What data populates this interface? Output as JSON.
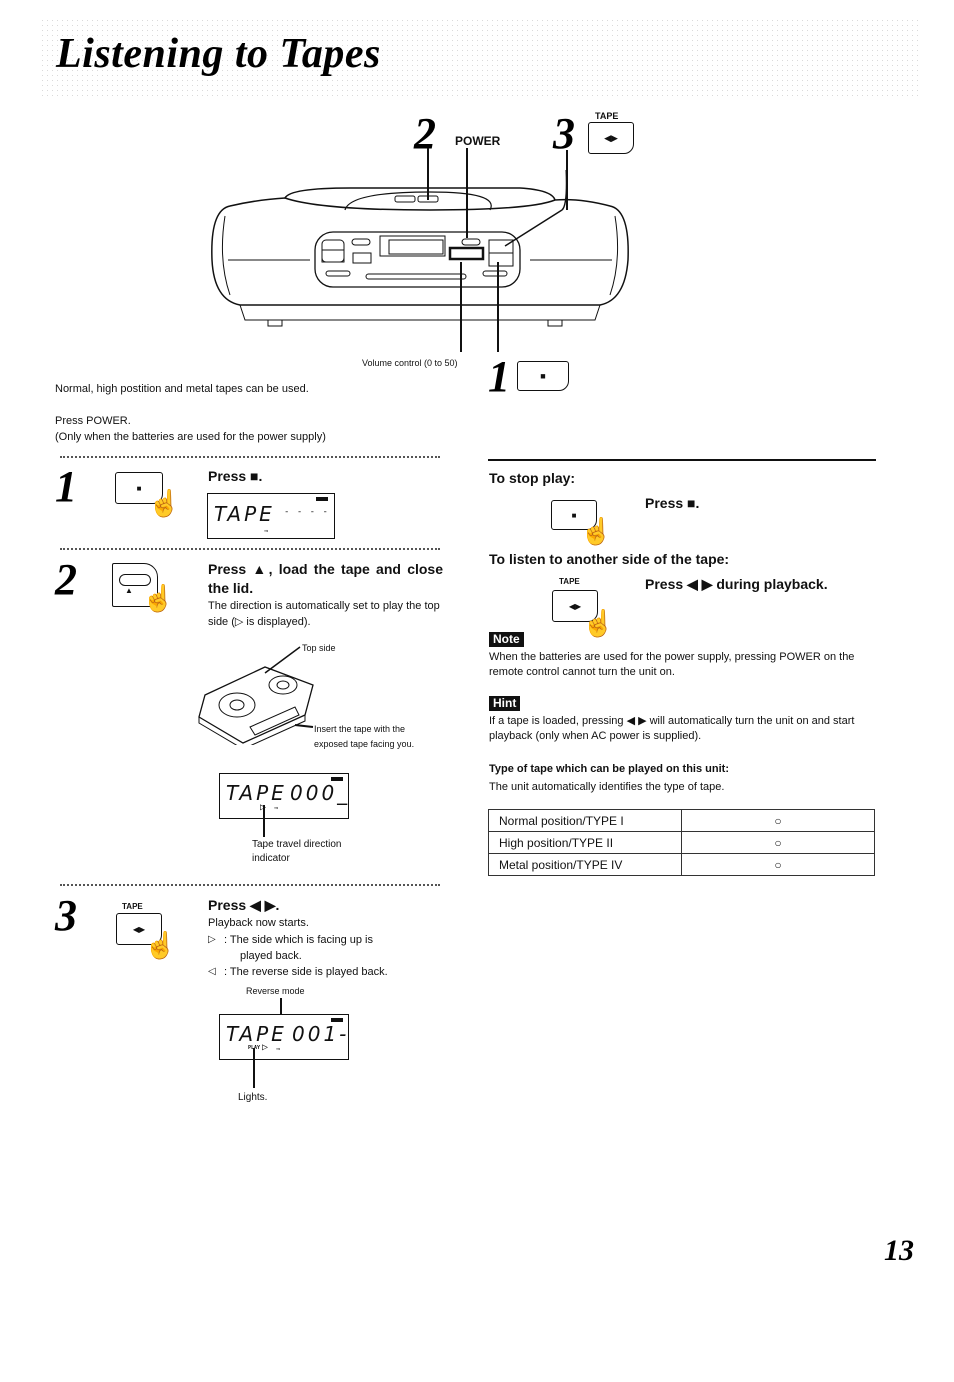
{
  "page": {
    "title": "Listening to Tapes",
    "page_number": "13"
  },
  "diagram": {
    "callout_2_num": "2",
    "callout_2_label": "POWER",
    "callout_3_num": "3",
    "callout_3_label": "TAPE",
    "callout_3_button": "◀▶",
    "callout_1_num": "1",
    "callout_1_button": "■",
    "volume_label": "Volume control (0 to 50)"
  },
  "intro": {
    "tapes_note": "Normal, high postition and metal tapes can be used.",
    "press_power": "Press POWER.",
    "power_note": "(Only when the batteries are used for the power supply)"
  },
  "steps": [
    {
      "num": "1",
      "heading": "Press ■.",
      "button_symbol": "■",
      "lcd_text": "TAPE",
      "lcd_value": "- - - -"
    },
    {
      "num": "2",
      "heading": "Press ▲, load the tape and close the lid.",
      "button_symbol": "▲",
      "body": "The direction is automatically set to play the top side (▷ is displayed).",
      "top_side_label": "Top side",
      "insert_label_1": "Insert the tape with the",
      "insert_label_2": "exposed tape facing you.",
      "lcd_text": "TAPE",
      "lcd_value": "000_",
      "indicator_label_1": "Tape travel direction",
      "indicator_label_2": "indicator"
    },
    {
      "num": "3",
      "heading": "Press ◀ ▶.",
      "button_label": "TAPE",
      "button_symbol": "◀▶",
      "body": "Playback now starts.",
      "forward_desc_1": ": The side which is facing up is",
      "forward_desc_2": "played back.",
      "reverse_desc": ": The reverse side is played back.",
      "reverse_mode_label": "Reverse mode",
      "lcd_text": "TAPE",
      "lcd_value": "001-",
      "lcd_play": "PLAY",
      "lights_label": "Lights."
    }
  ],
  "right": {
    "stop_heading": "To stop play:",
    "stop_action": "Press ■.",
    "stop_button": "■",
    "other_side_heading": "To listen to another side of the tape:",
    "other_side_button_label": "TAPE",
    "other_side_button": "◀▶",
    "other_side_action": "Press ◀ ▶ during playback.",
    "note_tag": "Note",
    "note_text": "When the batteries are used for the power supply, pressing POWER on the remote control cannot turn the unit on.",
    "hint_tag": "Hint",
    "hint_text": "If a tape is loaded, pressing ◀ ▶ will automatically turn the unit on and start playback (only when AC power is supplied).",
    "types_heading": "Type of tape which can be played on this unit:",
    "types_sub": "The unit automatically identifies the type of tape.",
    "tape_types": [
      {
        "type": "Normal position/TYPE I",
        "supported": "○"
      },
      {
        "type": "High position/TYPE II",
        "supported": "○"
      },
      {
        "type": "Metal position/TYPE IV",
        "supported": "○"
      }
    ]
  }
}
